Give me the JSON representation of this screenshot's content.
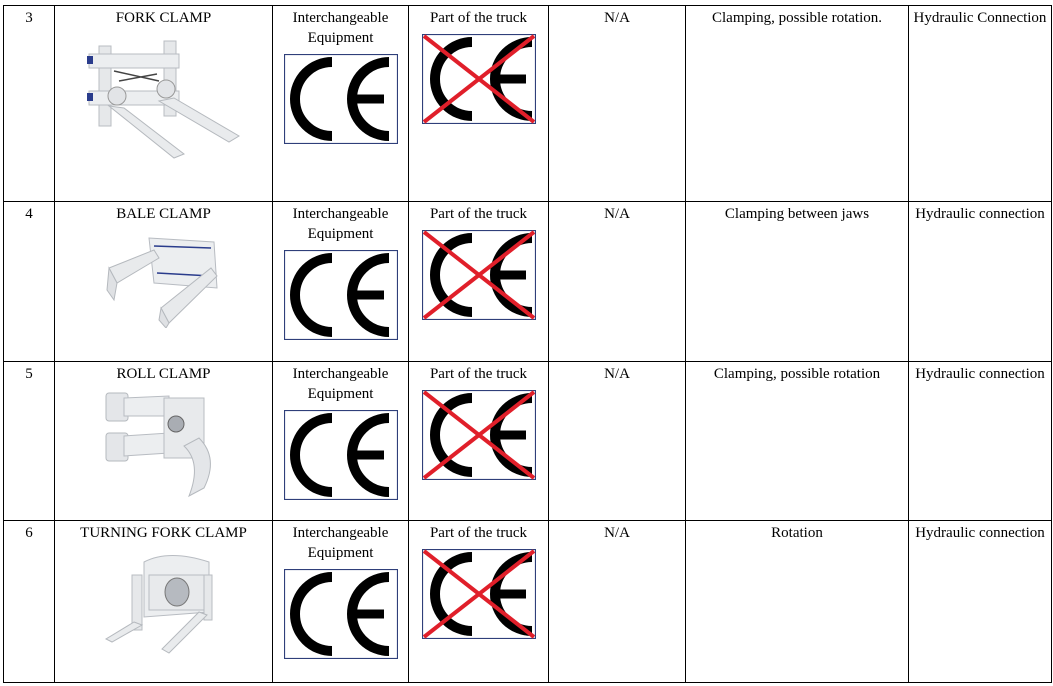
{
  "table": {
    "rows": [
      {
        "number": "3",
        "name": "FORK CLAMP",
        "image": "fork-clamp-image",
        "classification": "Interchangeable Equipment",
        "ce_marking": "ce-mark-icon",
        "truck_part_label": "Part of the truck",
        "truck_part_mark": "crossed-out-ce-mark-icon",
        "applicability": "N/A",
        "function": "Clamping, possible rotation.",
        "connection": "Hydraulic Connection"
      },
      {
        "number": "4",
        "name": "BALE CLAMP",
        "image": "bale-clamp-image",
        "classification": "Interchangeable Equipment",
        "ce_marking": "ce-mark-icon",
        "truck_part_label": "Part of the truck",
        "truck_part_mark": "crossed-out-ce-mark-icon",
        "applicability": "N/A",
        "function": "Clamping between jaws",
        "connection": "Hydraulic connection"
      },
      {
        "number": "5",
        "name": "ROLL CLAMP",
        "image": "roll-clamp-image",
        "classification": "Interchangeable Equipment",
        "ce_marking": "ce-mark-icon",
        "truck_part_label": "Part of the truck",
        "truck_part_mark": "crossed-out-ce-mark-icon",
        "applicability": "N/A",
        "function": "Clamping, possible rotation",
        "connection": "Hydraulic connection"
      },
      {
        "number": "6",
        "name": "TURNING FORK CLAMP",
        "image": "turning-fork-clamp-image",
        "classification": "Interchangeable Equipment",
        "ce_marking": "ce-mark-icon",
        "truck_part_label": "Part of the truck",
        "truck_part_mark": "crossed-out-ce-mark-icon",
        "applicability": "N/A",
        "function": "Rotation",
        "connection": "Hydraulic connection"
      }
    ]
  },
  "colors": {
    "border": "#000000",
    "ce_frame": "#2f3f7a",
    "cross": "#e01f2a",
    "machine": "#e6e8ea",
    "machine_accent": "#2a3c8c"
  }
}
